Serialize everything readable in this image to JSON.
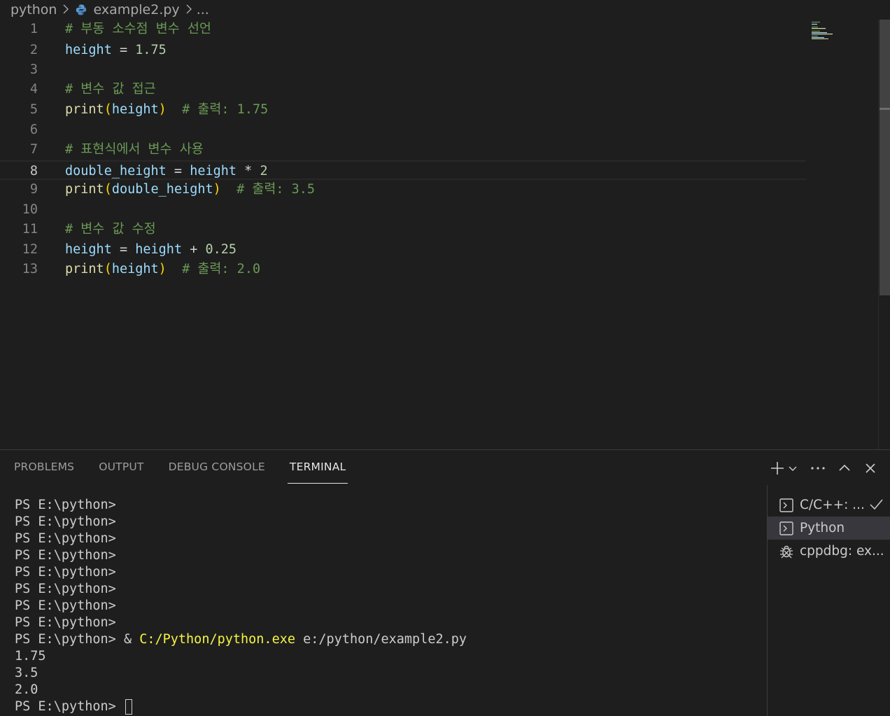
{
  "breadcrumb": {
    "folder": "python",
    "file": "example2.py",
    "more": "..."
  },
  "editor": {
    "lines": [
      {
        "num": "1",
        "tokens": [
          {
            "t": "com",
            "v": "# 부동 소수점 변수 선언"
          }
        ]
      },
      {
        "num": "2",
        "tokens": [
          {
            "t": "var",
            "v": "height"
          },
          {
            "t": "op",
            "v": " = "
          },
          {
            "t": "num",
            "v": "1.75"
          }
        ]
      },
      {
        "num": "3",
        "tokens": []
      },
      {
        "num": "4",
        "tokens": [
          {
            "t": "com",
            "v": "# 변수 값 접근"
          }
        ]
      },
      {
        "num": "5",
        "tokens": [
          {
            "t": "fn",
            "v": "print"
          },
          {
            "t": "par",
            "v": "("
          },
          {
            "t": "var",
            "v": "height"
          },
          {
            "t": "par",
            "v": ")"
          },
          {
            "t": "txt",
            "v": "  "
          },
          {
            "t": "com",
            "v": "# 출력: 1.75"
          }
        ]
      },
      {
        "num": "6",
        "tokens": []
      },
      {
        "num": "7",
        "tokens": [
          {
            "t": "com",
            "v": "# 표현식에서 변수 사용"
          }
        ]
      },
      {
        "num": "8",
        "tokens": [
          {
            "t": "var",
            "v": "double_height"
          },
          {
            "t": "op",
            "v": " = "
          },
          {
            "t": "var",
            "v": "height"
          },
          {
            "t": "op",
            "v": " * "
          },
          {
            "t": "num",
            "v": "2"
          }
        ]
      },
      {
        "num": "9",
        "tokens": [
          {
            "t": "fn",
            "v": "print"
          },
          {
            "t": "par",
            "v": "("
          },
          {
            "t": "var",
            "v": "double_height"
          },
          {
            "t": "par",
            "v": ")"
          },
          {
            "t": "txt",
            "v": "  "
          },
          {
            "t": "com",
            "v": "# 출력: 3.5"
          }
        ]
      },
      {
        "num": "10",
        "tokens": []
      },
      {
        "num": "11",
        "tokens": [
          {
            "t": "com",
            "v": "# 변수 값 수정"
          }
        ]
      },
      {
        "num": "12",
        "tokens": [
          {
            "t": "var",
            "v": "height"
          },
          {
            "t": "op",
            "v": " = "
          },
          {
            "t": "var",
            "v": "height"
          },
          {
            "t": "op",
            "v": " + "
          },
          {
            "t": "num",
            "v": "0.25"
          }
        ]
      },
      {
        "num": "13",
        "tokens": [
          {
            "t": "fn",
            "v": "print"
          },
          {
            "t": "par",
            "v": "("
          },
          {
            "t": "var",
            "v": "height"
          },
          {
            "t": "par",
            "v": ")"
          },
          {
            "t": "txt",
            "v": "  "
          },
          {
            "t": "com",
            "v": "# 출력: 2.0"
          }
        ]
      }
    ],
    "active_line": "8"
  },
  "panel": {
    "tabs": [
      {
        "label": "PROBLEMS",
        "active": false
      },
      {
        "label": "OUTPUT",
        "active": false
      },
      {
        "label": "DEBUG CONSOLE",
        "active": false
      },
      {
        "label": "TERMINAL",
        "active": true
      }
    ],
    "actions": [
      "plus-icon",
      "chevron-down-icon",
      "ellipsis-icon",
      "chevron-up-icon",
      "close-icon"
    ]
  },
  "terminal": {
    "prompt": "PS E:\\python>",
    "lines": [
      {
        "type": "prompt",
        "cmd": ""
      },
      {
        "type": "prompt",
        "cmd": ""
      },
      {
        "type": "prompt",
        "cmd": ""
      },
      {
        "type": "prompt",
        "cmd": ""
      },
      {
        "type": "prompt",
        "cmd": ""
      },
      {
        "type": "prompt",
        "cmd": ""
      },
      {
        "type": "prompt",
        "cmd": ""
      },
      {
        "type": "prompt",
        "cmd": ""
      },
      {
        "type": "run",
        "amp": "&",
        "exe": "C:/Python/python.exe",
        "arg": "e:/python/example2.py"
      },
      {
        "type": "out",
        "text": "1.75"
      },
      {
        "type": "out",
        "text": "3.5"
      },
      {
        "type": "out",
        "text": "2.0"
      },
      {
        "type": "cursor"
      }
    ]
  },
  "terminal_list": [
    {
      "icon": "terminal-icon",
      "label": "C/C++: ...",
      "selected": false,
      "check": true
    },
    {
      "icon": "terminal-icon",
      "label": "Python",
      "selected": true,
      "check": false
    },
    {
      "icon": "debug-icon",
      "label": "cppdbg: ex...",
      "selected": false,
      "check": false
    }
  ],
  "colors": {
    "background": "#1e1e1e",
    "comment": "#6a9955",
    "variable": "#9cdcfe",
    "function": "#dcdcaa",
    "number": "#b5cea8",
    "bracket": "#ffd700",
    "terminal_exe": "#f5f543"
  }
}
